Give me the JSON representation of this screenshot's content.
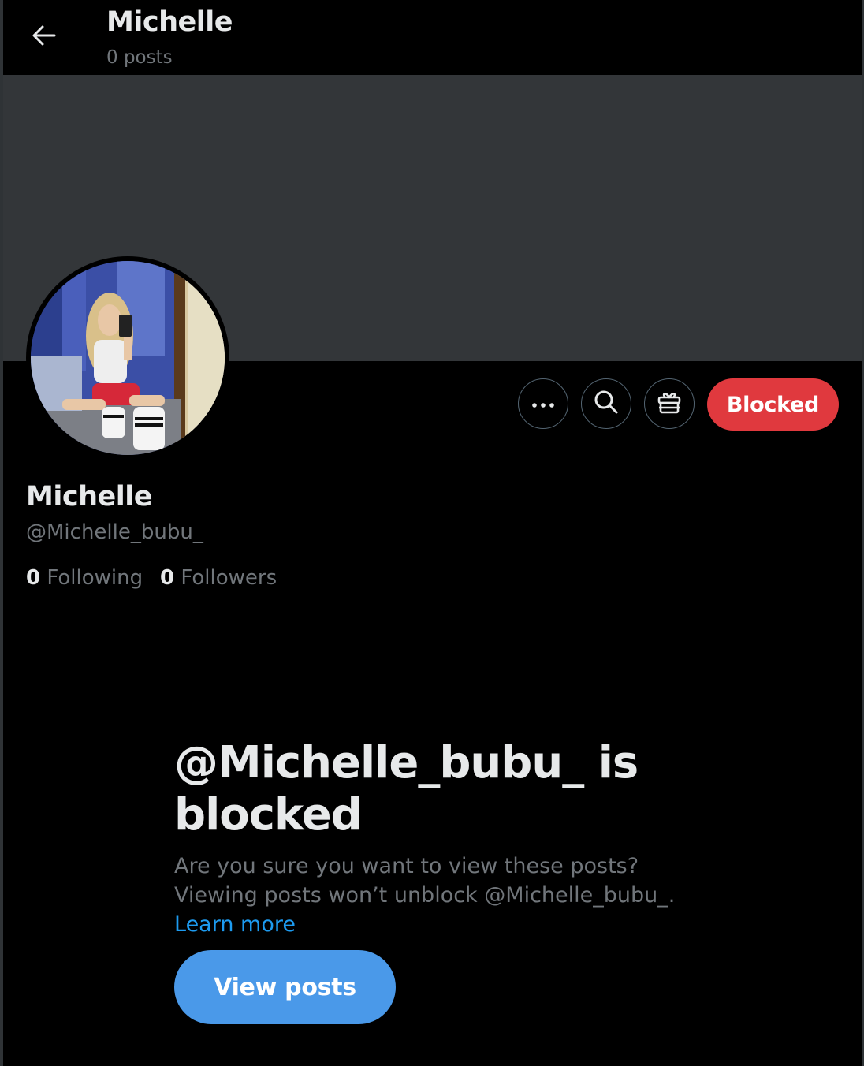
{
  "header": {
    "title": "Michelle",
    "posts_count": "0 posts"
  },
  "profile": {
    "name": "Michelle",
    "handle": "@Michelle_bubu_",
    "following_count": "0",
    "following_label": "Following",
    "followers_count": "0",
    "followers_label": "Followers"
  },
  "actions": {
    "more_icon": "more-horizontal-icon",
    "search_icon": "search-icon",
    "gift_icon": "gift-icon",
    "blocked_label": "Blocked"
  },
  "blocked_notice": {
    "title": "@Michelle_bubu_ is blocked",
    "description": "Are you sure you want to view these posts? Viewing posts won’t unblock @Michelle_bubu_.",
    "learn_more": "Learn more",
    "view_posts_label": "View posts"
  },
  "colors": {
    "background": "#000000",
    "banner": "#333639",
    "blocked_button": "#e0393e",
    "view_posts_button": "#4a99e9",
    "link": "#1d9bf0",
    "secondary_text": "#71767b",
    "primary_text": "#e7e9ea"
  }
}
